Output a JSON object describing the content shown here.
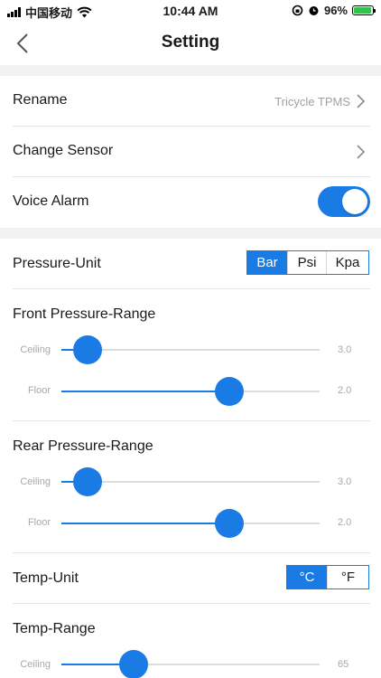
{
  "status_bar": {
    "carrier": "中国移动",
    "time": "10:44 AM",
    "battery": "96%"
  },
  "nav": {
    "title": "Setting"
  },
  "rename": {
    "label": "Rename",
    "value": "Tricycle TPMS"
  },
  "change_sensor": {
    "label": "Change Sensor"
  },
  "voice_alarm": {
    "label": "Voice Alarm",
    "enabled": true
  },
  "pressure_unit": {
    "label": "Pressure-Unit",
    "options": [
      "Bar",
      "Psi",
      "Kpa"
    ],
    "selected": "Bar"
  },
  "front_range": {
    "title": "Front Pressure-Range",
    "ceiling": {
      "label": "Ceiling",
      "value": "3.0",
      "fraction": 0.1
    },
    "floor": {
      "label": "Floor",
      "value": "2.0",
      "fraction": 0.65
    }
  },
  "rear_range": {
    "title": "Rear Pressure-Range",
    "ceiling": {
      "label": "Ceiling",
      "value": "3.0",
      "fraction": 0.1
    },
    "floor": {
      "label": "Floor",
      "value": "2.0",
      "fraction": 0.65
    }
  },
  "temp_unit": {
    "label": "Temp-Unit",
    "options": [
      "°C",
      "°F"
    ],
    "selected": "°C"
  },
  "temp_range": {
    "title": "Temp-Range",
    "ceiling": {
      "label": "Ceiling",
      "value": "65",
      "fraction": 0.28
    }
  },
  "colors": {
    "accent": "#1a7be4",
    "band": "#f2f2f2",
    "divider": "#e5e5e5",
    "muted": "#a8a8a8"
  }
}
